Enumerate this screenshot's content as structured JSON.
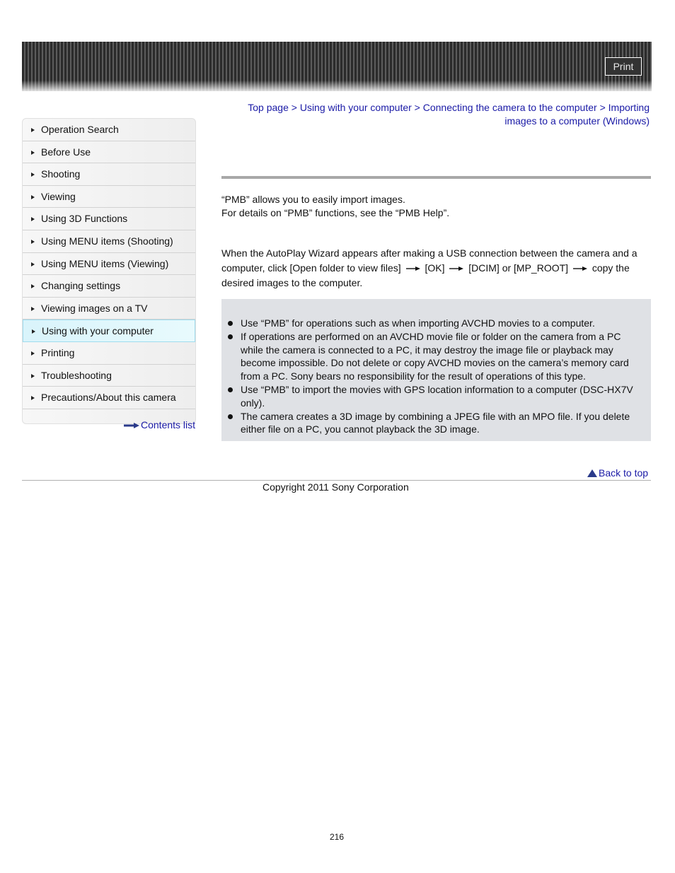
{
  "header": {
    "print_label": "Print"
  },
  "sidebar": {
    "items": [
      {
        "label": "Operation Search",
        "active": false
      },
      {
        "label": "Before Use",
        "active": false
      },
      {
        "label": "Shooting",
        "active": false
      },
      {
        "label": "Viewing",
        "active": false
      },
      {
        "label": "Using 3D Functions",
        "active": false
      },
      {
        "label": "Using MENU items (Shooting)",
        "active": false
      },
      {
        "label": "Using MENU items (Viewing)",
        "active": false
      },
      {
        "label": "Changing settings",
        "active": false
      },
      {
        "label": "Viewing images on a TV",
        "active": false
      },
      {
        "label": "Using with your computer",
        "active": true
      },
      {
        "label": "Printing",
        "active": false
      },
      {
        "label": "Troubleshooting",
        "active": false
      },
      {
        "label": "Precautions/About this camera",
        "active": false
      }
    ],
    "contents_list_label": "Contents list"
  },
  "breadcrumb": {
    "items": [
      "Top page",
      "Using with your computer",
      "Connecting the camera to the computer",
      "Importing images to a computer (Windows)"
    ],
    "separator": ">"
  },
  "content": {
    "intro_line1": "“PMB” allows you to easily import images.",
    "intro_line2": "For details on “PMB” functions, see the “PMB Help”.",
    "steps": {
      "prefix": "When the AutoPlay Wizard appears after making a USB connection between the camera and a computer, click [Open folder to view files]",
      "step2": "[OK]",
      "step3": "[DCIM] or [MP_ROOT]",
      "step4": "copy the desired images to the computer."
    },
    "notes": [
      "Use “PMB” for operations such as when importing AVCHD movies to a computer.",
      "If operations are performed on an AVCHD movie file or folder on the camera from a PC while the camera is connected to a PC, it may destroy the image file or playback may become impossible. Do not delete or copy AVCHD movies on the camera’s memory card from a PC. Sony bears no responsibility for the result of operations of this type.",
      "Use “PMB” to import the movies with GPS location information to a computer (DSC-HX7V only).",
      "The camera creates a 3D image by combining a JPEG file with an MPO file. If you delete either file on a PC, you cannot playback the 3D image."
    ]
  },
  "footer": {
    "back_to_top_label": "Back to top",
    "copyright": "Copyright 2011 Sony Corporation",
    "page_number": "216"
  }
}
